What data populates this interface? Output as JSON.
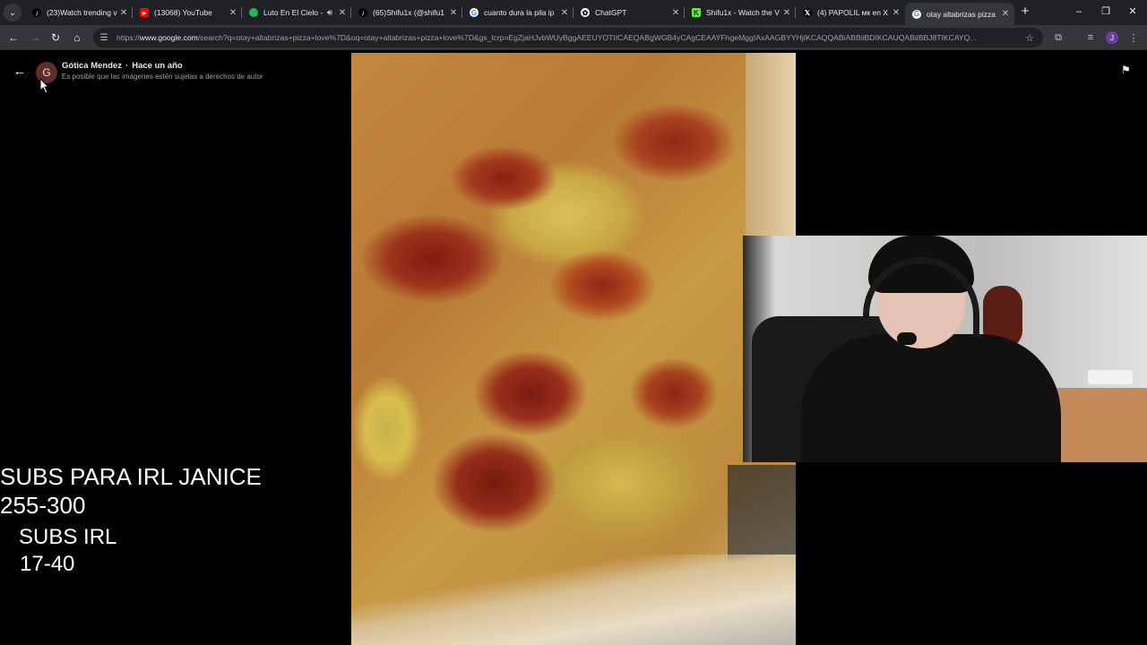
{
  "browser": {
    "tabs": [
      {
        "title": "(23)Watch trending v",
        "icon": "tiktok-icon",
        "color": "#000000"
      },
      {
        "title": "(13068) YouTube",
        "icon": "youtube-icon",
        "color": "#ff0000"
      },
      {
        "title": "Luto En El Cielo -",
        "icon": "spotify-icon",
        "color": "#1db954"
      },
      {
        "title": "(65)Shifu1x (@shifu1",
        "icon": "tiktok-icon",
        "color": "#000000"
      },
      {
        "title": "cuanto dura la pila ip",
        "icon": "google-icon",
        "color": "#ffffff"
      },
      {
        "title": "ChatGPT",
        "icon": "chatgpt-icon",
        "color": "#ffffff"
      },
      {
        "title": "Shifu1x - Watch the V",
        "icon": "kick-icon",
        "color": "#53fc18"
      },
      {
        "title": "(4) PAPOLIL мк en X",
        "icon": "x-icon",
        "color": "#000000"
      },
      {
        "title": "otay altabrizas pizza",
        "icon": "google-icon",
        "color": "#ffffff"
      }
    ],
    "active_tab": 8,
    "address": {
      "prefix": "https://",
      "host": "www.google.com",
      "path": "/search?q=otay+altabrizas+pizza+love%7D&oq=otay+altabrizas+pizza+love%7D&gs_lcrp=EgZjaHJvbWUyBggAEEUYOTIICAEQABgWGB4yCAgCEAAYFhgeMggIAxAAGBYYHjIKCAQQABiABBiiBDIKCAUQABiiBBJ8TIKCAYQ..."
    },
    "profile_initial": "J"
  },
  "viewer": {
    "author": "Gótica Mendez",
    "time": "Hace un año",
    "avatar_initial": "G",
    "copyright_notice": "Es posible que las imágenes estén sujetas a derechos de autor"
  },
  "overlay": {
    "line1": "SUBS PARA IRL JANICE",
    "line2": "255-300",
    "line3": "SUBS IRL",
    "line4": "17-40"
  },
  "colors": {
    "tabstrip": "#202124",
    "toolbar": "#35363a",
    "page_bg": "#000000"
  }
}
